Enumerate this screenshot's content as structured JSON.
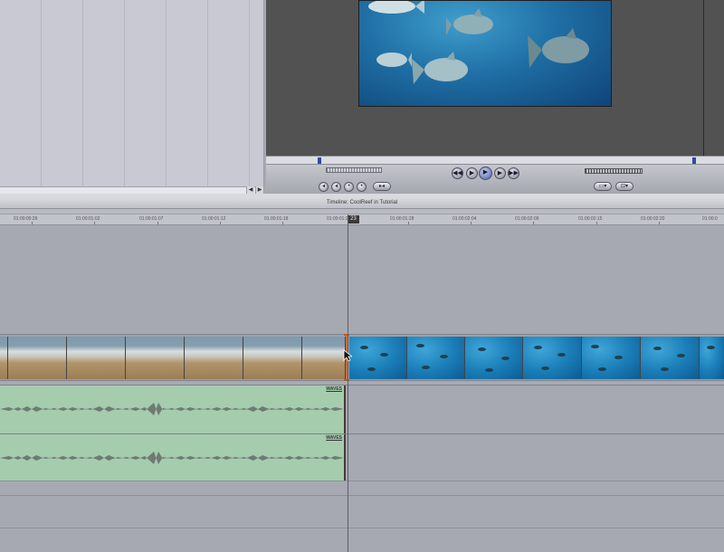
{
  "timeline": {
    "title": "Timeline: CoolReef in Tutorial",
    "playhead_timecode": "23",
    "ruler_ticks": [
      "01:00:00:26",
      "01:00:01:02",
      "01:00:01:07",
      "01:00:01:12",
      "01:00:01:18",
      "01:00:01:23",
      "01:00:01:28",
      "01:00:02:04",
      "01:00:02:09",
      "01:00:02:15",
      "01:00:02:20",
      "01:00:0"
    ]
  },
  "tracks": {
    "audio1_clip_name": "WAVES",
    "audio2_clip_name": "WAVES"
  },
  "icons": {
    "fish": "fish-icon",
    "arrow_cursor": "arrow-cursor-icon"
  },
  "colors": {
    "audio_clip": "#a4ccad",
    "edit_point": "#c96f3a",
    "in_out_marker": "#3148a8"
  }
}
